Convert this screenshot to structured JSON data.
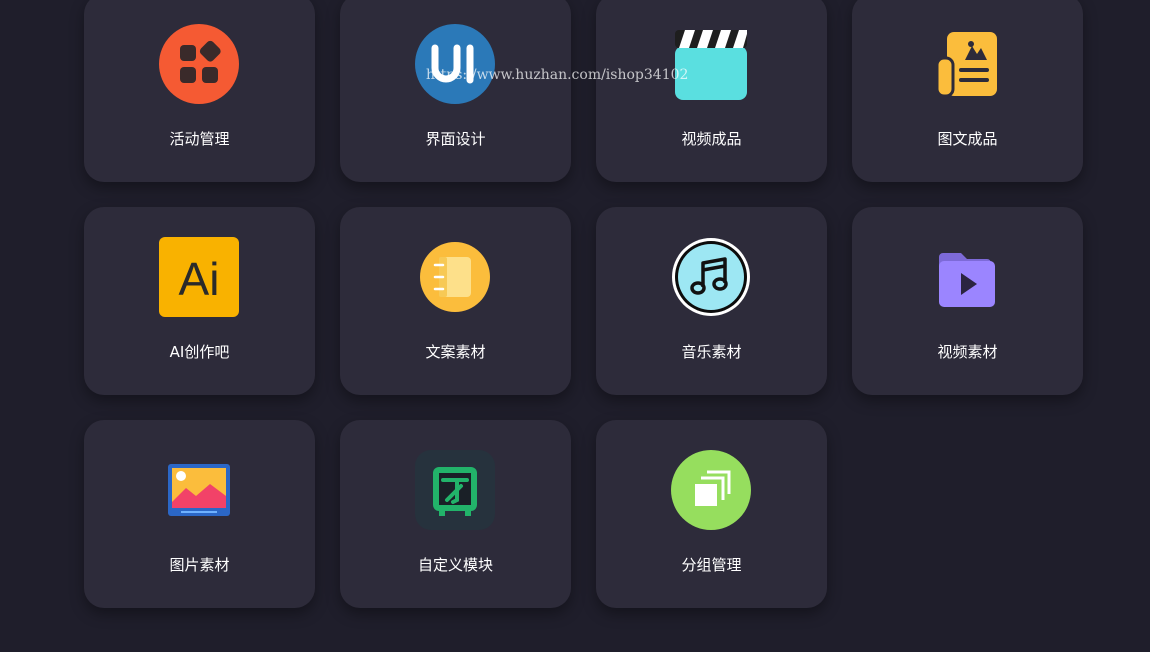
{
  "watermark": "https://www.huzhan.com/ishop34102",
  "cards": [
    {
      "label": "活动管理",
      "icon": "apps-grid-icon"
    },
    {
      "label": "界面设计",
      "icon": "ui-design-icon"
    },
    {
      "label": "视频成品",
      "icon": "clapperboard-icon"
    },
    {
      "label": "图文成品",
      "icon": "newspaper-icon"
    },
    {
      "label": "AI创作吧",
      "icon": "ai-logo-icon",
      "icon_text": "Ai"
    },
    {
      "label": "文案素材",
      "icon": "notebook-icon"
    },
    {
      "label": "音乐素材",
      "icon": "music-note-icon"
    },
    {
      "label": "视频素材",
      "icon": "video-folder-icon"
    },
    {
      "label": "图片素材",
      "icon": "image-picture-icon"
    },
    {
      "label": "自定义模块",
      "icon": "custom-module-icon"
    },
    {
      "label": "分组管理",
      "icon": "group-layers-icon"
    }
  ],
  "colors": {
    "background": "#1f1e2b",
    "card": "#2d2b3a",
    "label": "#ffffff"
  }
}
